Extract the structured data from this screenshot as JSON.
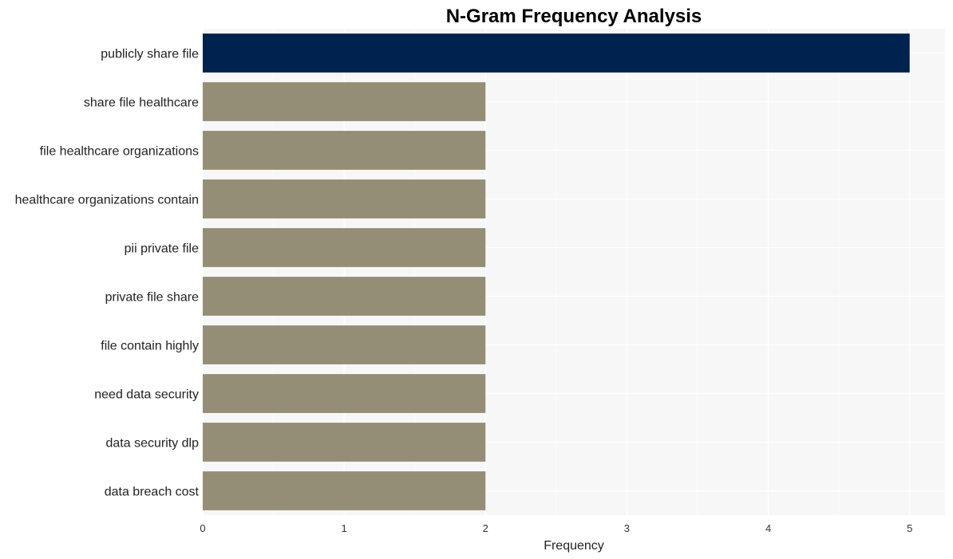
{
  "chart_data": {
    "type": "bar",
    "orientation": "horizontal",
    "title": "N-Gram Frequency Analysis",
    "xlabel": "Frequency",
    "ylabel": "",
    "categories": [
      "publicly share file",
      "share file healthcare",
      "file healthcare organizations",
      "healthcare organizations contain",
      "pii private file",
      "private file share",
      "file contain highly",
      "need data security",
      "data security dlp",
      "data breach cost"
    ],
    "values": [
      5,
      2,
      2,
      2,
      2,
      2,
      2,
      2,
      2,
      2
    ],
    "xlim": [
      0,
      5.25
    ],
    "xticks": [
      0,
      1,
      2,
      3,
      4,
      5
    ],
    "xtick_labels": [
      "0",
      "1",
      "2",
      "3",
      "4",
      "5"
    ],
    "grid": true,
    "legend": "none",
    "colors": {
      "highlight": "#00224e",
      "default": "#958e77",
      "panel_background": "#f7f7f7",
      "gridline": "#ffffff"
    }
  }
}
